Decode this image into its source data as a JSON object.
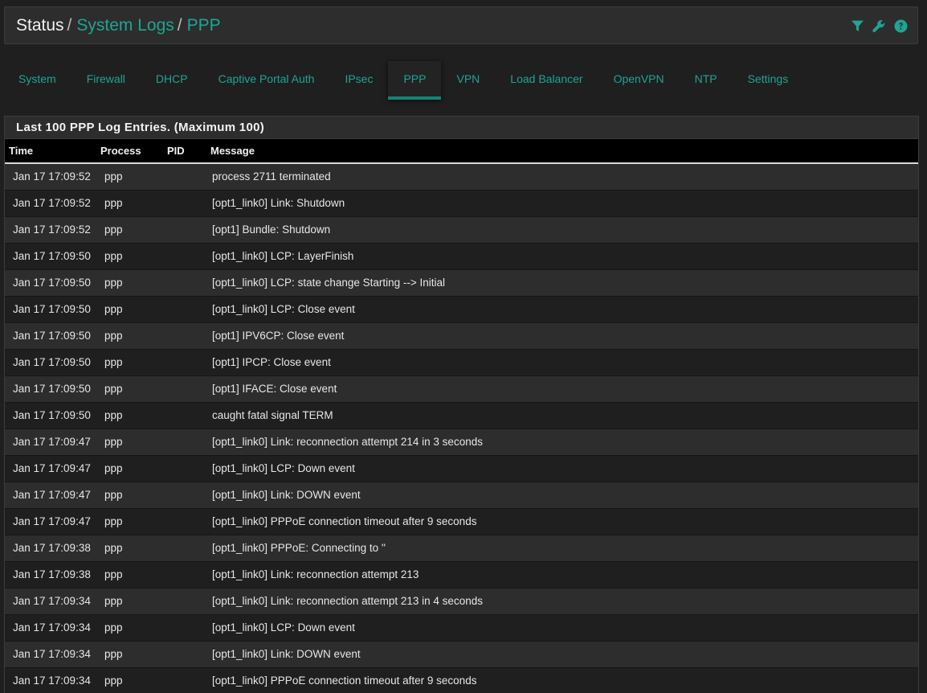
{
  "breadcrumb": {
    "root": "Status",
    "sep": "/",
    "level1": "System Logs",
    "level2": "PPP"
  },
  "header_icons": [
    "filter-icon",
    "wrench-icon",
    "help-icon"
  ],
  "colors": {
    "accent": "#1ea594",
    "background": "#1f1f1f",
    "panel_heading": "#2d2d2d",
    "table_header": "#000000"
  },
  "tabs": [
    {
      "label": "System",
      "active": false
    },
    {
      "label": "Firewall",
      "active": false
    },
    {
      "label": "DHCP",
      "active": false
    },
    {
      "label": "Captive Portal Auth",
      "active": false
    },
    {
      "label": "IPsec",
      "active": false
    },
    {
      "label": "PPP",
      "active": true
    },
    {
      "label": "VPN",
      "active": false
    },
    {
      "label": "Load Balancer",
      "active": false
    },
    {
      "label": "OpenVPN",
      "active": false
    },
    {
      "label": "NTP",
      "active": false
    },
    {
      "label": "Settings",
      "active": false
    }
  ],
  "panel": {
    "title": "Last 100 PPP Log Entries. (Maximum 100)"
  },
  "table": {
    "columns": [
      "Time",
      "Process",
      "PID",
      "Message"
    ],
    "rows": [
      {
        "time": "Jan 17 17:09:52",
        "process": "ppp",
        "pid": "",
        "message": "process 2711 terminated"
      },
      {
        "time": "Jan 17 17:09:52",
        "process": "ppp",
        "pid": "",
        "message": "[opt1_link0] Link: Shutdown"
      },
      {
        "time": "Jan 17 17:09:52",
        "process": "ppp",
        "pid": "",
        "message": "[opt1] Bundle: Shutdown"
      },
      {
        "time": "Jan 17 17:09:50",
        "process": "ppp",
        "pid": "",
        "message": "[opt1_link0] LCP: LayerFinish"
      },
      {
        "time": "Jan 17 17:09:50",
        "process": "ppp",
        "pid": "",
        "message": "[opt1_link0] LCP: state change Starting --> Initial"
      },
      {
        "time": "Jan 17 17:09:50",
        "process": "ppp",
        "pid": "",
        "message": "[opt1_link0] LCP: Close event"
      },
      {
        "time": "Jan 17 17:09:50",
        "process": "ppp",
        "pid": "",
        "message": "[opt1] IPV6CP: Close event"
      },
      {
        "time": "Jan 17 17:09:50",
        "process": "ppp",
        "pid": "",
        "message": "[opt1] IPCP: Close event"
      },
      {
        "time": "Jan 17 17:09:50",
        "process": "ppp",
        "pid": "",
        "message": "[opt1] IFACE: Close event"
      },
      {
        "time": "Jan 17 17:09:50",
        "process": "ppp",
        "pid": "",
        "message": "caught fatal signal TERM"
      },
      {
        "time": "Jan 17 17:09:47",
        "process": "ppp",
        "pid": "",
        "message": "[opt1_link0] Link: reconnection attempt 214 in 3 seconds"
      },
      {
        "time": "Jan 17 17:09:47",
        "process": "ppp",
        "pid": "",
        "message": "[opt1_link0] LCP: Down event"
      },
      {
        "time": "Jan 17 17:09:47",
        "process": "ppp",
        "pid": "",
        "message": "[opt1_link0] Link: DOWN event"
      },
      {
        "time": "Jan 17 17:09:47",
        "process": "ppp",
        "pid": "",
        "message": "[opt1_link0] PPPoE connection timeout after 9 seconds"
      },
      {
        "time": "Jan 17 17:09:38",
        "process": "ppp",
        "pid": "",
        "message": "[opt1_link0] PPPoE: Connecting to ''"
      },
      {
        "time": "Jan 17 17:09:38",
        "process": "ppp",
        "pid": "",
        "message": "[opt1_link0] Link: reconnection attempt 213"
      },
      {
        "time": "Jan 17 17:09:34",
        "process": "ppp",
        "pid": "",
        "message": "[opt1_link0] Link: reconnection attempt 213 in 4 seconds"
      },
      {
        "time": "Jan 17 17:09:34",
        "process": "ppp",
        "pid": "",
        "message": "[opt1_link0] LCP: Down event"
      },
      {
        "time": "Jan 17 17:09:34",
        "process": "ppp",
        "pid": "",
        "message": "[opt1_link0] Link: DOWN event"
      },
      {
        "time": "Jan 17 17:09:34",
        "process": "ppp",
        "pid": "",
        "message": "[opt1_link0] PPPoE connection timeout after 9 seconds"
      }
    ]
  }
}
